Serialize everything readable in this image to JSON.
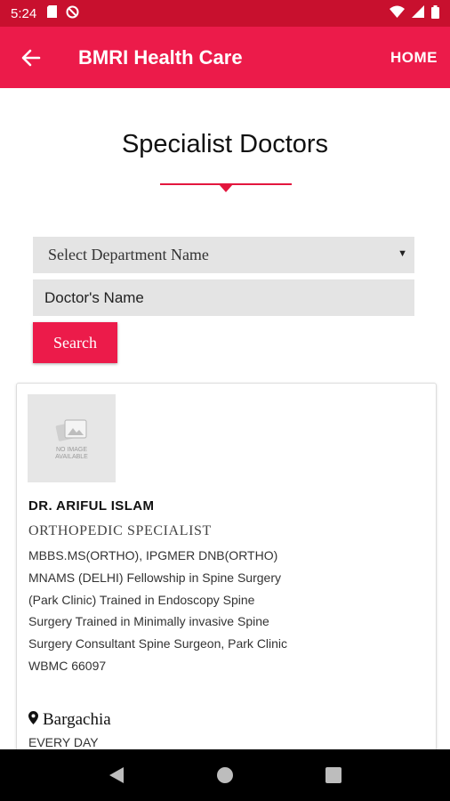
{
  "status_bar": {
    "time": "5:24"
  },
  "app_bar": {
    "title": "BMRI Health Care",
    "home_label": "HOME"
  },
  "page": {
    "title": "Specialist Doctors"
  },
  "form": {
    "department_select": "Select Department Name",
    "doctor_name_placeholder": "Doctor's Name",
    "search_label": "Search"
  },
  "doctor": {
    "photo_text": "NO IMAGE AVAILABLE",
    "name": "DR. ARIFUL ISLAM",
    "specialty": "ORTHOPEDIC SPECIALIST",
    "qualifications": "MBBS.MS(ORTHO), IPGMER DNB(ORTHO) MNAMS (DELHI) Fellowship in Spine Surgery (Park Clinic) Trained in Endoscopy Spine Surgery Trained in Minimally invasive Spine Surgery Consultant Spine Surgeon, Park Clinic WBMC 66097",
    "location": "Bargachia",
    "schedule": "EVERY DAY"
  },
  "colors": {
    "primary": "#ec1b4a",
    "status_bar": "#c8102e",
    "field_bg": "#e4e4e4"
  },
  "icons": {
    "status": [
      "sim-icon",
      "do-not-disturb-icon",
      "wifi-icon",
      "signal-icon",
      "battery-icon"
    ],
    "back": "back-arrow-icon",
    "location": "location-pin-icon",
    "nav": [
      "nav-back-icon",
      "nav-home-icon",
      "nav-recents-icon"
    ]
  }
}
